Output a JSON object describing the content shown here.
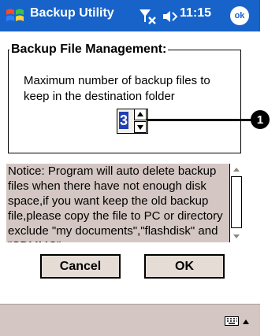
{
  "titlebar": {
    "app_title": "Backup Utility",
    "clock": "11:15",
    "ok_label": "ok",
    "start_icon": "windows-flag-icon",
    "signal_icon": "no-signal-icon",
    "volume_icon": "speaker-icon",
    "color": "#1763c9"
  },
  "group": {
    "legend": "Backup File Management:",
    "description": "Maximum number of backup files to keep in the destination folder",
    "spinner_value": "3"
  },
  "callout": {
    "number": "1"
  },
  "notice": {
    "text": "Notice: Program will auto delete backup files when there have not enough disk space,if you want keep the old backup file,please copy the file to PC or directory exclude \"my documents\",\"flashdisk\" and \"SDMMC\"."
  },
  "buttons": {
    "cancel": "Cancel",
    "ok": "OK"
  },
  "bottombar": {
    "keyboard_icon": "keyboard-icon",
    "sip_arrow_icon": "up-arrow-icon"
  }
}
